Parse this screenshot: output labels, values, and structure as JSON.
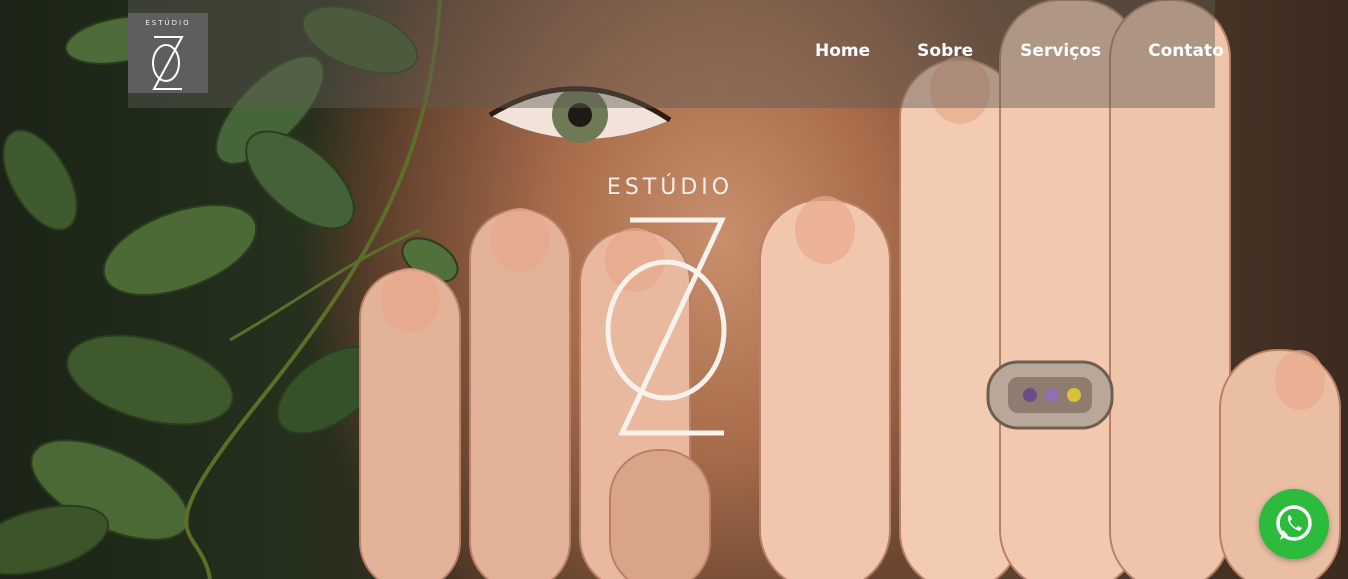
{
  "brand": {
    "small_logo_word": "ESTÚDIO",
    "hero_logo_word": "ESTÚDIO",
    "monogram": "OZ"
  },
  "nav": {
    "items": [
      {
        "label": "Home"
      },
      {
        "label": "Sobre"
      },
      {
        "label": "Serviços"
      },
      {
        "label": "Contato"
      }
    ]
  },
  "colors": {
    "header_band": "#5f5a55",
    "logo_box": "#5e5e5e",
    "whatsapp": "#2cbb3d",
    "nav_text": "#ffffff"
  },
  "icons": {
    "whatsapp": "whatsapp-icon"
  }
}
